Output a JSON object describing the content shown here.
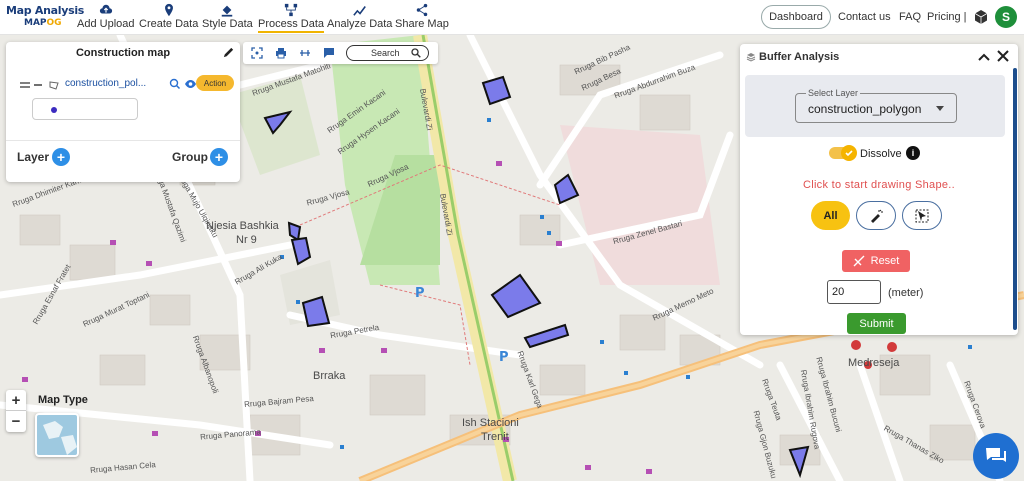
{
  "app": {
    "logo_line1": "Map Analysis",
    "logo_line2_a": "MAP",
    "logo_line2_b": "OG"
  },
  "nav": {
    "items": [
      {
        "label": "Add Upload",
        "icon": "cloud-upload-icon"
      },
      {
        "label": "Create Data",
        "icon": "map-pin-icon"
      },
      {
        "label": "Style Data",
        "icon": "paint-bucket-icon"
      },
      {
        "label": "Process Data",
        "icon": "process-nodes-icon",
        "active": true
      },
      {
        "label": "Analyze Data",
        "icon": "analyze-chart-icon"
      },
      {
        "label": "Share Map",
        "icon": "share-icon"
      }
    ],
    "dashboard": "Dashboard",
    "contact": "Contact us",
    "faq": "FAQ",
    "pricing": "Pricing |",
    "avatar_initial": "S"
  },
  "layer_panel": {
    "title": "Construction map",
    "layer_name": "construction_pol...",
    "action_label": "Action",
    "layer_color": "#3c2cc0",
    "layer_label": "Layer",
    "group_label": "Group"
  },
  "tools": {
    "search_label": "Search"
  },
  "buffer": {
    "title": "Buffer Analysis",
    "select_label": "Select Layer",
    "select_value": "construction_polygon",
    "dissolve_label": "Dissolve",
    "dissolve_on": true,
    "hint": "Click to start drawing Shape..",
    "mode_all": "All",
    "reset_label": "Reset",
    "distance_value": "20",
    "distance_unit": "(meter)",
    "submit_label": "Submit"
  },
  "map": {
    "map_type_label": "Map Type",
    "zoom_in": "+",
    "zoom_out": "−",
    "labels": [
      {
        "text": "Njesia Bashkia",
        "cls": "big"
      },
      {
        "text": "Nr 9",
        "cls": "big"
      },
      {
        "text": "Brraka",
        "cls": "big"
      },
      {
        "text": "Medreseja",
        "cls": "big"
      },
      {
        "text": "Ish Stacioni",
        "cls": "big"
      },
      {
        "text": "Trenit",
        "cls": "big"
      },
      {
        "text": "Bulevardi Zi",
        "cls": ""
      },
      {
        "text": "Bulevardi Zi",
        "cls": ""
      },
      {
        "text": "Rruga Vjosa",
        "cls": ""
      },
      {
        "text": "Rruga Vjosa",
        "cls": ""
      },
      {
        "text": "Rruga Emin Kacani",
        "cls": ""
      },
      {
        "text": "Rruga Hysen Kacani",
        "cls": ""
      },
      {
        "text": "Rruga Bib Pasha",
        "cls": ""
      },
      {
        "text": "Rruga Besa",
        "cls": ""
      },
      {
        "text": "Rruga Abdurrahim Buza",
        "cls": ""
      },
      {
        "text": "Rruga Zenel Bastari",
        "cls": ""
      },
      {
        "text": "Rruga Ali Kuka",
        "cls": ""
      },
      {
        "text": "Rruga Petrela",
        "cls": ""
      },
      {
        "text": "Rruga Bajram Pesa",
        "cls": ""
      },
      {
        "text": "Rruga Panorama",
        "cls": ""
      },
      {
        "text": "Rruga Hasan Cela",
        "cls": ""
      },
      {
        "text": "Rruga Mustafa Matohiti",
        "cls": ""
      },
      {
        "text": "Rruga Memo Meto",
        "cls": ""
      },
      {
        "text": "Rruga Karl Gega",
        "cls": ""
      },
      {
        "text": "Rruga Ibrahim Rugova",
        "cls": ""
      },
      {
        "text": "Rruga Thanas Ziko",
        "cls": ""
      },
      {
        "text": "Rruga Cerova",
        "cls": ""
      },
      {
        "text": "Rruga Mujo Ulqinaku",
        "cls": ""
      },
      {
        "text": "Rruga Murat Toptani",
        "cls": ""
      },
      {
        "text": "Rruga Albanopoli",
        "cls": ""
      },
      {
        "text": "Rruga Esnaf Fratet",
        "cls": ""
      },
      {
        "text": "Rruga Mustafa Qazimi",
        "cls": ""
      },
      {
        "text": "Rruga Dhimiter Kamarda",
        "cls": ""
      },
      {
        "text": "Rruga Teuta",
        "cls": ""
      },
      {
        "text": "Rruga Gjon Buzuku",
        "cls": ""
      },
      {
        "text": "Rruga Ibrahim Bucuni",
        "cls": ""
      }
    ]
  }
}
